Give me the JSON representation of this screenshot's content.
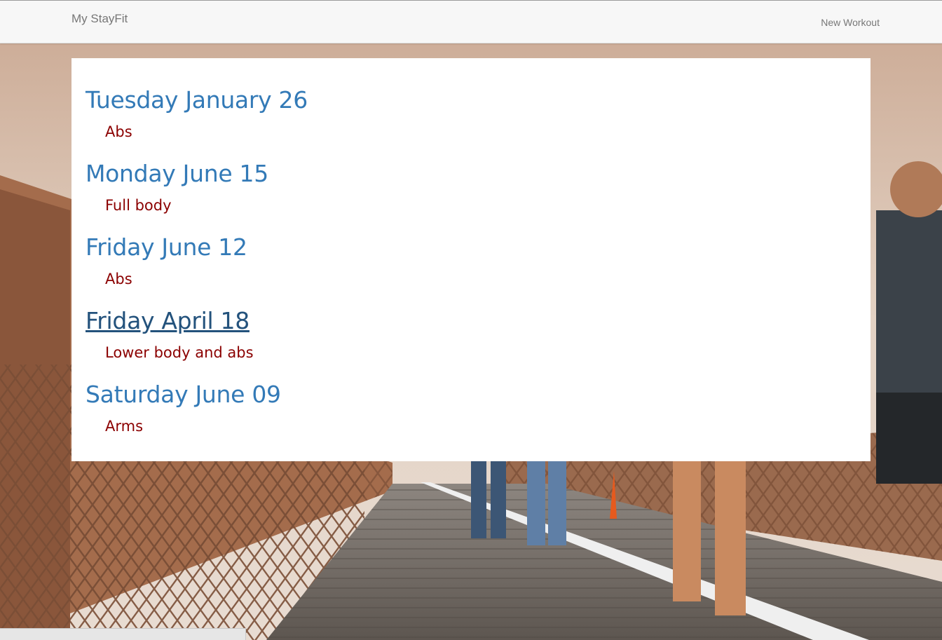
{
  "navbar": {
    "brand": "My StayFit",
    "new_workout": "New Workout"
  },
  "workouts": [
    {
      "date": "Tuesday January 26",
      "name": "Abs"
    },
    {
      "date": "Monday June 15",
      "name": "Full body"
    },
    {
      "date": "Friday June 12",
      "name": "Abs"
    },
    {
      "date": "Friday April 18",
      "name": "Lower body and abs"
    },
    {
      "date": "Saturday June 09",
      "name": "Arms"
    }
  ],
  "colors": {
    "date_link": "#337ab7",
    "date_link_hover": "#23527c",
    "workout_name": "#8b0000",
    "navbar_bg": "#f7f7f7",
    "navbar_text": "#777777"
  }
}
